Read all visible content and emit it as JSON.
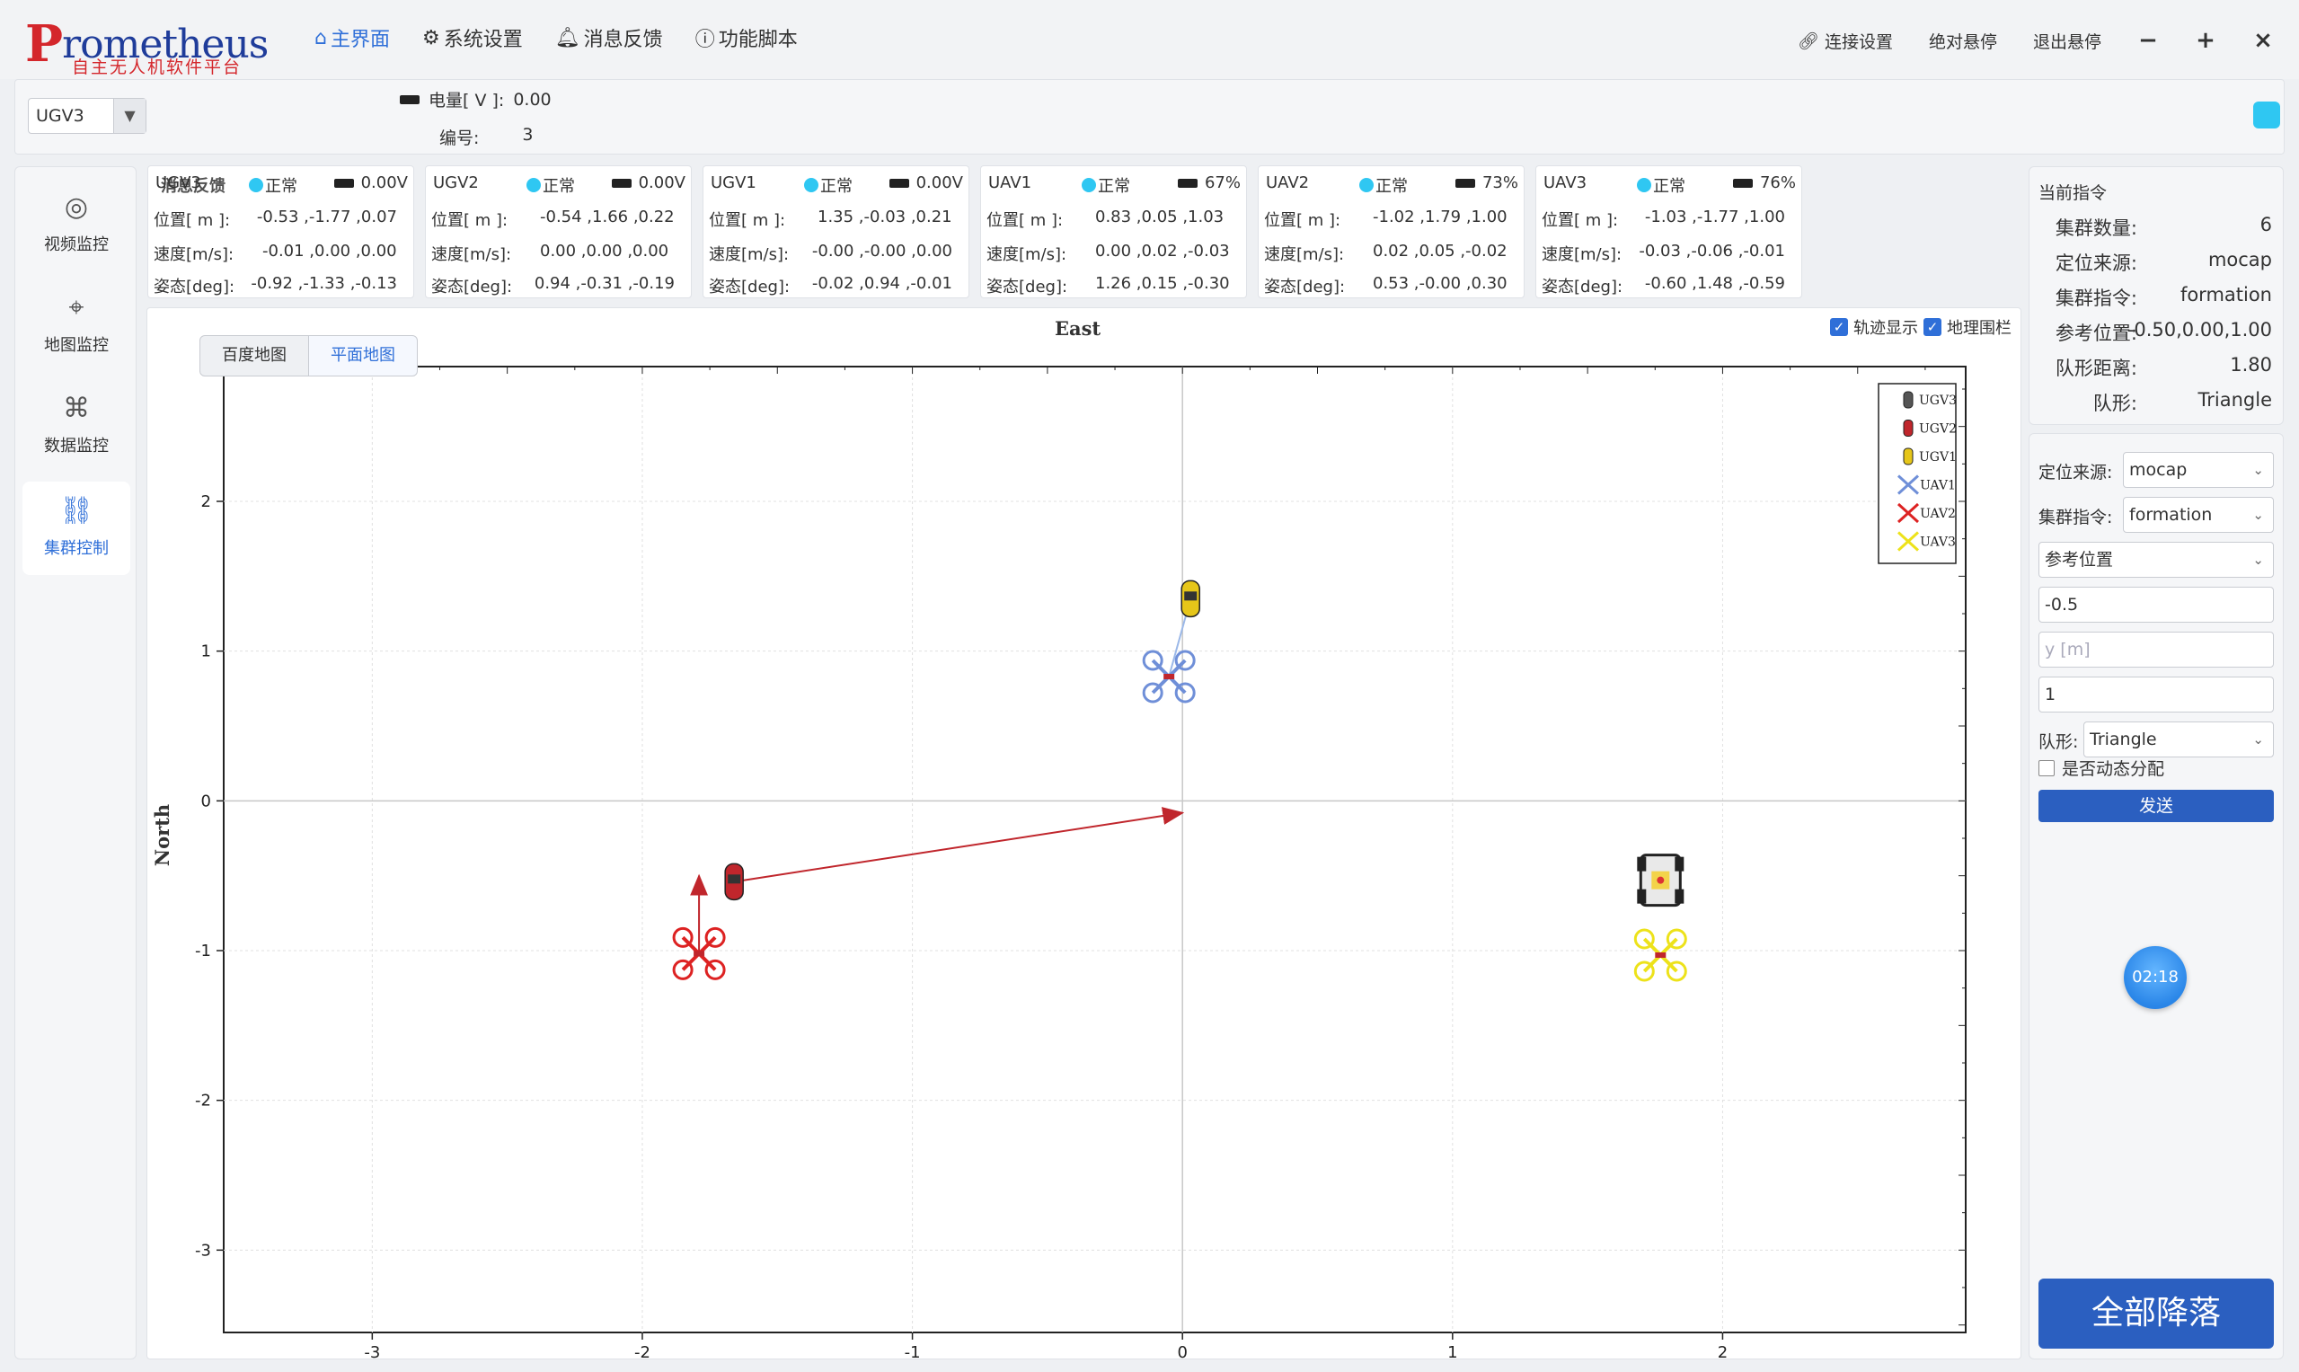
{
  "app": {
    "logo_text": "rometheus",
    "logo_letter": "P",
    "logo_subtitle": "自主无人机软件平台"
  },
  "nav": [
    {
      "label": "主界面",
      "icon": "home-icon",
      "active": true
    },
    {
      "label": "系统设置",
      "icon": "settings-icon",
      "active": false
    },
    {
      "label": "消息反馈",
      "icon": "bell-icon",
      "active": false
    },
    {
      "label": "功能脚本",
      "icon": "help-icon",
      "active": false
    }
  ],
  "topright": {
    "connect": "连接设置",
    "abs_hover": "绝对悬停",
    "exit_hover": "退出悬停",
    "minimize": "−",
    "maximize": "+",
    "close": "×"
  },
  "selector": {
    "value": "UGV3",
    "battery_label": "电量[ V ]:",
    "battery_value": "0.00",
    "id_label": "编号:",
    "id_value": "3",
    "status_color": "#2fc7f2"
  },
  "sidebar": [
    {
      "label": "视频监控",
      "icon": "camera-icon",
      "active": false
    },
    {
      "label": "地图监控",
      "icon": "map-pin-icon",
      "active": false
    },
    {
      "label": "数据监控",
      "icon": "drone-icon",
      "active": false
    },
    {
      "label": "集群控制",
      "icon": "hierarchy-icon",
      "active": true
    }
  ],
  "cards": [
    {
      "name": "UGV3",
      "name_overlay": "消息反馈",
      "status": "正常",
      "battery": "0.00V",
      "pos_label": "位置[ m ]:",
      "pos": "-0.53 ,-1.77 ,0.07",
      "vel_label": "速度[m/s]:",
      "vel": "-0.01 ,0.00 ,0.00",
      "att_label": "姿态[deg]:",
      "att": "-0.92 ,-1.33 ,-0.13"
    },
    {
      "name": "UGV2",
      "status": "正常",
      "battery": "0.00V",
      "pos_label": "位置[ m ]:",
      "pos": "-0.54 ,1.66 ,0.22",
      "vel_label": "速度[m/s]:",
      "vel": "0.00 ,0.00 ,0.00",
      "att_label": "姿态[deg]:",
      "att": "0.94 ,-0.31 ,-0.19"
    },
    {
      "name": "UGV1",
      "status": "正常",
      "battery": "0.00V",
      "pos_label": "位置[ m ]:",
      "pos": "1.35 ,-0.03 ,0.21",
      "vel_label": "速度[m/s]:",
      "vel": "-0.00 ,-0.00 ,0.00",
      "att_label": "姿态[deg]:",
      "att": "-0.02 ,0.94 ,-0.01"
    },
    {
      "name": "UAV1",
      "status": "正常",
      "battery": "67%",
      "pos_label": "位置[ m ]:",
      "pos": "0.83 ,0.05 ,1.03",
      "vel_label": "速度[m/s]:",
      "vel": "0.00 ,0.02 ,-0.03",
      "att_label": "姿态[deg]:",
      "att": "1.26 ,0.15 ,-0.30"
    },
    {
      "name": "UAV2",
      "status": "正常",
      "battery": "73%",
      "pos_label": "位置[ m ]:",
      "pos": "-1.02 ,1.79 ,1.00",
      "vel_label": "速度[m/s]:",
      "vel": "0.02 ,0.05 ,-0.02",
      "att_label": "姿态[deg]:",
      "att": "0.53 ,-0.00 ,0.30"
    },
    {
      "name": "UAV3",
      "status": "正常",
      "battery": "76%",
      "pos_label": "位置[ m ]:",
      "pos": "-1.03 ,-1.77 ,1.00",
      "vel_label": "速度[m/s]:",
      "vel": "-0.03 ,-0.06 ,-0.01",
      "att_label": "姿态[deg]:",
      "att": "-0.60 ,1.48 ,-0.59"
    }
  ],
  "map": {
    "tabs": [
      {
        "label": "百度地图",
        "active": false
      },
      {
        "label": "平面地图",
        "active": true
      }
    ],
    "track_label": "轨迹显示",
    "track_checked": true,
    "fence_label": "地理围栏",
    "fence_checked": true
  },
  "chart_data": {
    "type": "scatter",
    "title": "East",
    "xlabel": "East",
    "ylabel": "North",
    "xlim": [
      -3.55,
      2.9
    ],
    "ylim": [
      -3.55,
      2.9
    ],
    "xticks": [
      -3,
      -2,
      -1,
      0,
      1,
      2
    ],
    "yticks": [
      2,
      1,
      0,
      -1,
      -2,
      -3
    ],
    "grid": true,
    "legend_position": "top-right",
    "series": [
      {
        "name": "UGV3",
        "x": 1.77,
        "y": -0.53,
        "color": "#555555",
        "marker": "ugv"
      },
      {
        "name": "UGV2",
        "x": -1.66,
        "y": -0.54,
        "color": "#c0262c",
        "marker": "ugv"
      },
      {
        "name": "UGV1",
        "x": 0.03,
        "y": 1.35,
        "color": "#e6c619",
        "marker": "ugv"
      },
      {
        "name": "UAV1",
        "x": -0.05,
        "y": 0.83,
        "color": "#6f8fd8",
        "marker": "uav"
      },
      {
        "name": "UAV2",
        "x": -1.79,
        "y": -1.02,
        "color": "#dd2222",
        "marker": "uav"
      },
      {
        "name": "UAV3",
        "x": 1.77,
        "y": -1.03,
        "color": "#ede21a",
        "marker": "uav"
      }
    ],
    "arrows": [
      {
        "from": [
          -1.66,
          -0.54
        ],
        "to": [
          0.0,
          -0.08
        ],
        "color": "#c0262c"
      },
      {
        "from": [
          -1.79,
          -1.02
        ],
        "to": [
          -1.79,
          -0.5
        ],
        "color": "#c0262c"
      }
    ],
    "tracks": [
      {
        "from": [
          0.03,
          1.35
        ],
        "to": [
          -0.05,
          0.83
        ],
        "color": "#9bb8e8"
      }
    ]
  },
  "info": {
    "title": "当前指令",
    "rows": [
      {
        "k": "集群数量:",
        "v": "6"
      },
      {
        "k": "定位来源:",
        "v": "mocap"
      },
      {
        "k": "集群指令:",
        "v": "formation"
      },
      {
        "k": "参考位置:",
        "v": "-0.50,0.00,1.00"
      },
      {
        "k": "队形距离:",
        "v": "1.80"
      },
      {
        "k": "队形:",
        "v": "Triangle"
      }
    ]
  },
  "control": {
    "loc_label": "定位来源:",
    "loc_value": "mocap",
    "cmd_label": "集群指令:",
    "cmd_value": "formation",
    "ref_value": "参考位置",
    "x_value": "-0.5",
    "y_placeholder": "y [m]",
    "z_value": "1",
    "formation_label": "队形:",
    "formation_value": "Triangle",
    "dynamic_label": "是否动态分配",
    "send_label": "发送",
    "timer": "02:18",
    "land_label": "全部降落"
  }
}
